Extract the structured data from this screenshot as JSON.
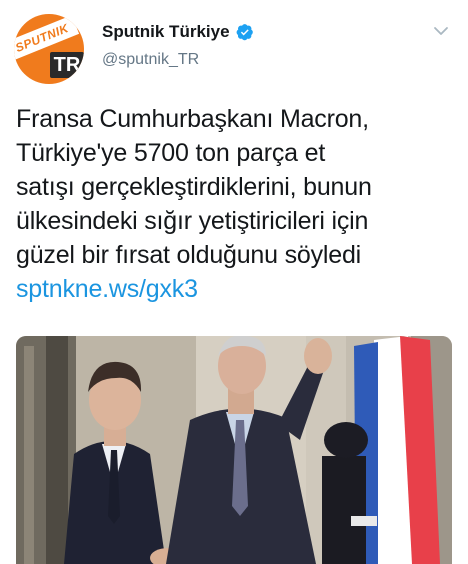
{
  "header": {
    "display_name": "Sputnik Türkiye",
    "handle": "@sputnik_TR",
    "avatar": {
      "logo_word": "SPUTNIK",
      "logo_tag": "TR"
    },
    "verified": true
  },
  "tweet": {
    "text_lines": [
      "Fransa Cumhurbaşkanı Macron,",
      "Türkiye'ye 5700 ton parça et",
      "satışı gerçekleştirdiklerini, bunun",
      "ülkesindeki sığır yetiştiricileri için",
      "güzel bir fırsat olduğunu söyledi"
    ],
    "link": "sptnkne.ws/gxk3"
  },
  "colors": {
    "brand": "#f07b1d",
    "link": "#1b95e0",
    "verified": "#1da1f2",
    "muted": "#657786"
  },
  "icons": {
    "verified": "verified-badge-icon",
    "menu": "chevron-down-icon"
  }
}
